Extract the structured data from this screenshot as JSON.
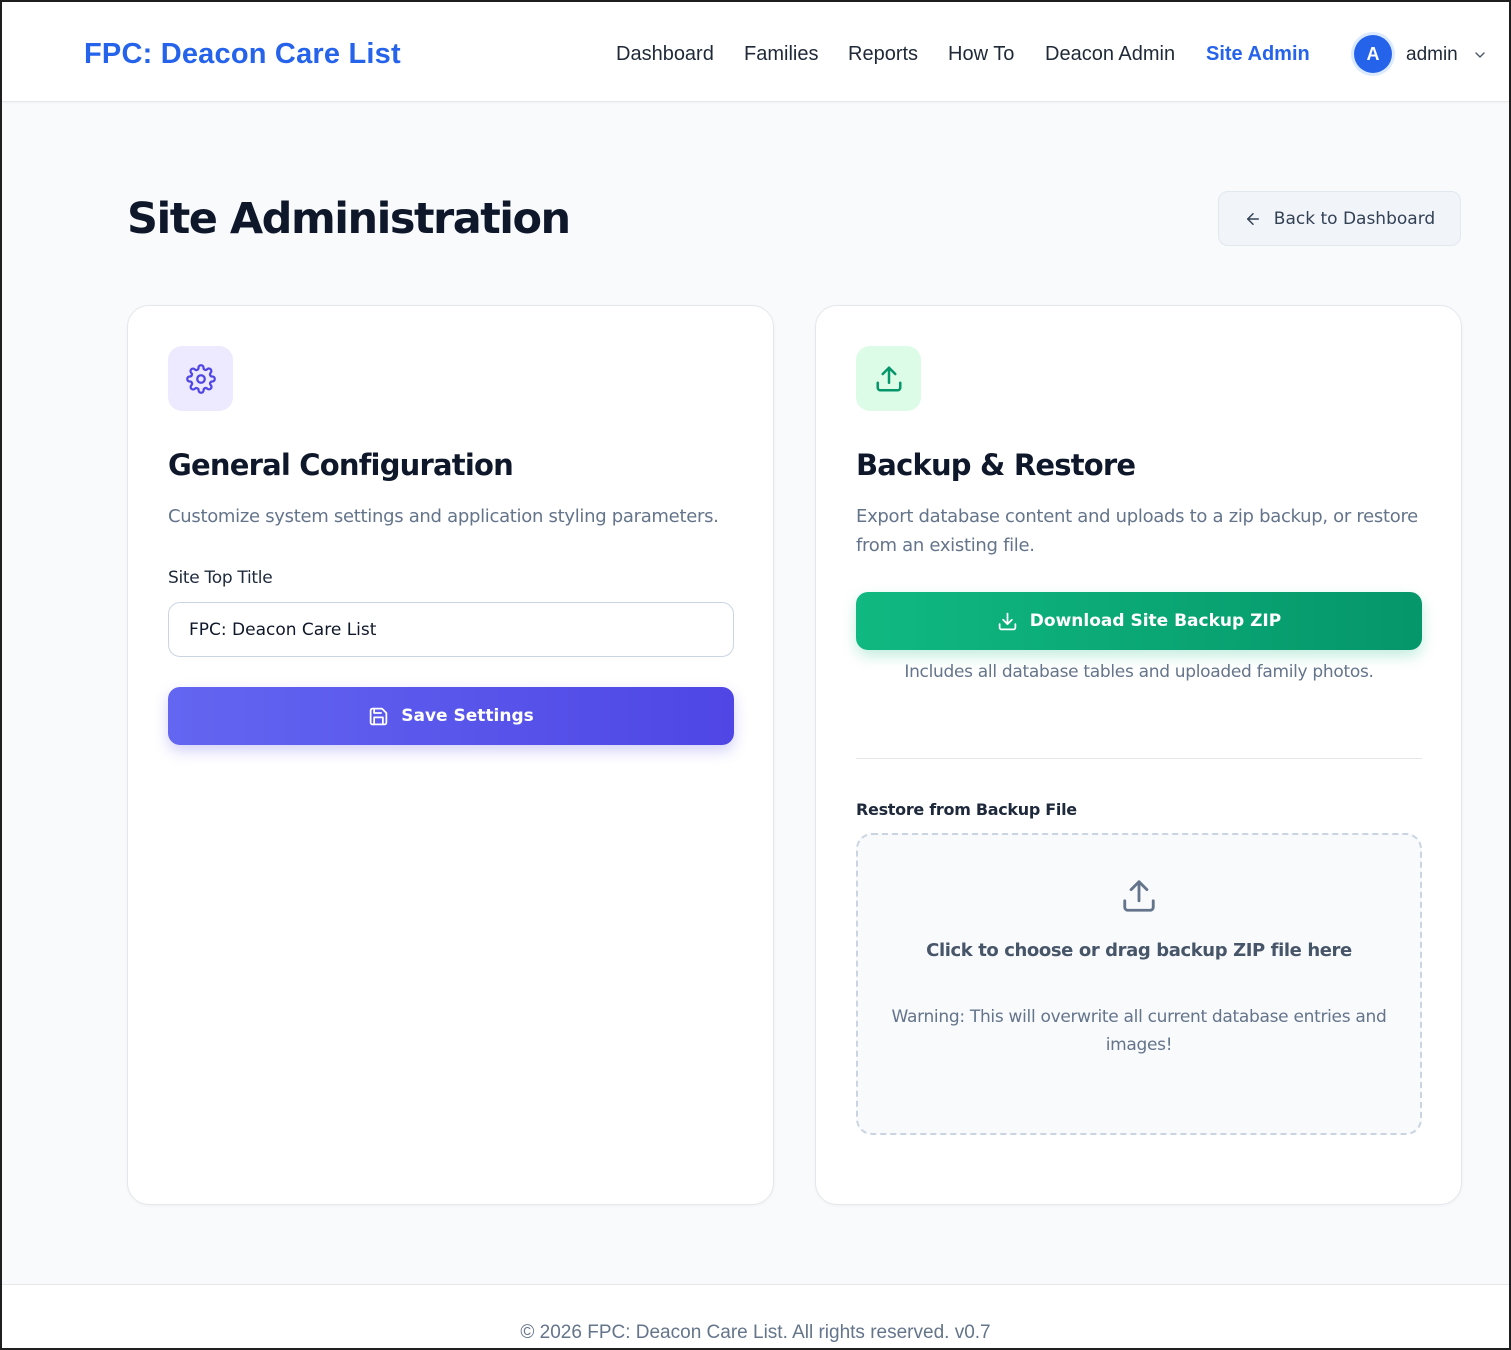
{
  "header": {
    "brand": "FPC: Deacon Care List",
    "nav": [
      {
        "label": "Dashboard",
        "active": false
      },
      {
        "label": "Families",
        "active": false
      },
      {
        "label": "Reports",
        "active": false
      },
      {
        "label": "How To",
        "active": false
      },
      {
        "label": "Deacon Admin",
        "active": false
      },
      {
        "label": "Site Admin",
        "active": true
      }
    ],
    "user": {
      "initial": "A",
      "name": "admin",
      "menu_icon": "chevron-down-icon"
    }
  },
  "page": {
    "title": "Site Administration",
    "back_button": "Back to Dashboard",
    "back_icon": "arrow-left-icon"
  },
  "general": {
    "icon": "gear-icon",
    "title": "General Configuration",
    "description": "Customize system settings and application styling parameters.",
    "site_title_label": "Site Top Title",
    "site_title_value": "FPC: Deacon Care List",
    "save_label": "Save Settings",
    "save_icon": "save-icon"
  },
  "backup": {
    "icon": "upload-icon",
    "title": "Backup & Restore",
    "description": "Export database content and uploads to a zip backup, or restore from an existing file.",
    "download_label": "Download Site Backup ZIP",
    "download_icon": "download-icon",
    "download_note": "Includes all database tables and uploaded family photos.",
    "restore_label": "Restore from Backup File",
    "dropzone_title": "Click to choose or drag backup ZIP file here",
    "dropzone_warning": "Warning: This will overwrite all current database entries and images!"
  },
  "footer": {
    "text": "© 2026 FPC: Deacon Care List. All rights reserved. v0.7"
  },
  "colors": {
    "brand": "#2563eb",
    "primary_button": "#4f46e5",
    "success_button": "#059669",
    "page_background": "#f8fafc"
  }
}
